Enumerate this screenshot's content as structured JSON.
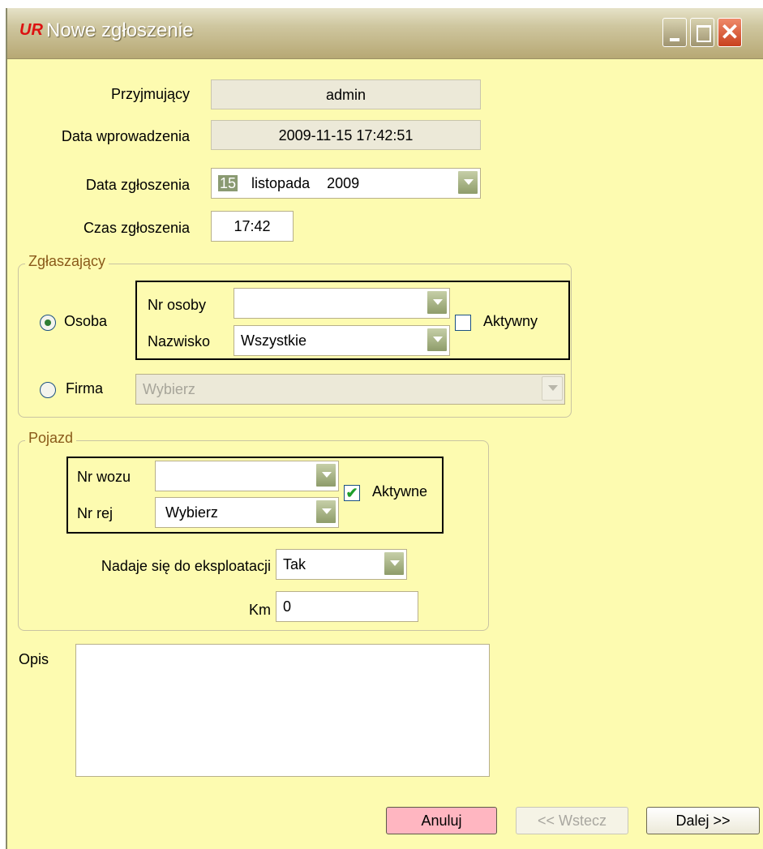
{
  "window": {
    "title": "Nowe zgłoszenie",
    "app_icon": "UR",
    "close_glyph": "✕"
  },
  "form": {
    "przyjmujacy": {
      "label": "Przyjmujący",
      "value": "admin"
    },
    "data_wprowadzenia": {
      "label": "Data wprowadzenia",
      "value": "2009-11-15 17:42:51"
    },
    "data_zgloszenia": {
      "label": "Data zgłoszenia",
      "day": "15",
      "month": "listopada",
      "year": "2009"
    },
    "czas_zgloszenia": {
      "label": "Czas zgłoszenia",
      "value": "17:42"
    }
  },
  "zglaszajacy": {
    "title": "Zgłaszający",
    "osoba": {
      "label": "Osoba",
      "selected": true
    },
    "nr_osoby": {
      "label": "Nr osoby",
      "value": ""
    },
    "nazwisko": {
      "label": "Nazwisko",
      "value": "Wszystkie"
    },
    "aktywny": {
      "label": "Aktywny",
      "checked": false
    },
    "firma": {
      "label": "Firma",
      "selected": false,
      "value": "Wybierz"
    }
  },
  "pojazd": {
    "title": "Pojazd",
    "nr_wozu": {
      "label": "Nr wozu",
      "value": ""
    },
    "nr_rej": {
      "label": "Nr rej",
      "value": "Wybierz"
    },
    "aktywne": {
      "label": "Aktywne",
      "checked": true,
      "mark": "✔"
    },
    "eksploatacja": {
      "label": "Nadaje się do eksploatacji",
      "value": "Tak"
    },
    "km": {
      "label": "Km",
      "value": "0"
    }
  },
  "opis": {
    "label": "Opis",
    "value": ""
  },
  "buttons": {
    "anuluj": "Anuluj",
    "wstecz": "<< Wstecz",
    "dalej": "Dalej >>"
  },
  "colors": {
    "window_bg": "#fdfbb0",
    "cancel_bg": "#ffb6c1",
    "group_title": "#8a5a1a"
  }
}
